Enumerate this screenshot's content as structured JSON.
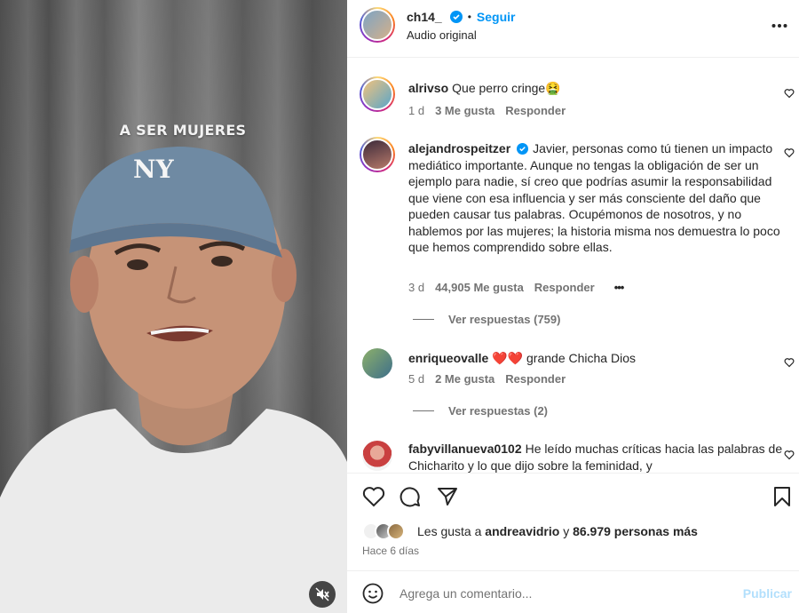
{
  "video": {
    "caption": "A SER MUJERES",
    "mute_icon": "speaker-muted-icon"
  },
  "header": {
    "username": "ch14_",
    "separator": "•",
    "follow_label": "Seguir",
    "audio": "Audio original",
    "more_icon": "more-horizontal-icon"
  },
  "comments": [
    {
      "username": "alrivso",
      "text": "Que perro cringe🤮",
      "time": "1 d",
      "likes": "3 Me gusta",
      "reply": "Responder"
    },
    {
      "username": "alejandrospeitzer",
      "verified": true,
      "text": "Javier, personas como tú tienen un impacto mediático importante. Aunque no tengas la obligación de ser un ejemplo para nadie, sí creo que podrías asumir la responsabilidad que viene con esa influencia y ser más consciente del daño que pueden causar tus palabras. Ocupémonos de nosotros, y no hablemos por las mujeres; la historia misma nos demuestra lo poco que hemos comprendido sobre ellas.",
      "time": "3 d",
      "likes": "44,905 Me gusta",
      "reply": "Responder",
      "more": "•••",
      "view_replies": "Ver respuestas (759)"
    },
    {
      "username": "enriqueovalle",
      "text": "❤️❤️ grande Chicha Dios",
      "time": "5 d",
      "likes": "2 Me gusta",
      "reply": "Responder",
      "view_replies": "Ver respuestas (2)"
    },
    {
      "username": "fabyvillanueva0102",
      "text": "He leído muchas críticas hacia las palabras de Chicharito y lo que dijo sobre la feminidad, y"
    }
  ],
  "actions": {
    "like_icon": "heart-icon",
    "comment_icon": "comment-icon",
    "share_icon": "send-icon",
    "save_icon": "bookmark-icon",
    "likes_prefix": "Les gusta a",
    "likes_user": "andreavidrio",
    "likes_and": "y",
    "likes_others": "86.979 personas más",
    "posted": "Hace 6 días"
  },
  "add_comment": {
    "emoji_icon": "emoji-icon",
    "placeholder": "Agrega un comentario...",
    "publish_label": "Publicar"
  },
  "colors": {
    "accent": "#0095f6",
    "publish_disabled": "#b2dffc",
    "muted_text": "#737373"
  }
}
